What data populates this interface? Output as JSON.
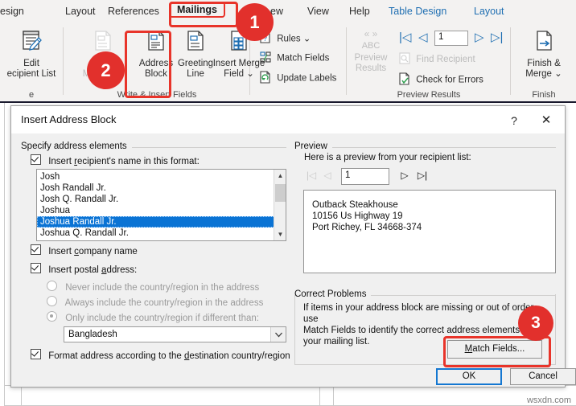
{
  "ribbon": {
    "tabs": [
      {
        "label": "esign",
        "type": "normal"
      },
      {
        "label": "Layout",
        "type": "normal"
      },
      {
        "label": "References",
        "type": "normal"
      },
      {
        "label": "Mailings",
        "type": "selected"
      },
      {
        "label": "ew",
        "type": "normal"
      },
      {
        "label": "View",
        "type": "normal"
      },
      {
        "label": "Help",
        "type": "normal"
      },
      {
        "label": "Table Design",
        "type": "contextual"
      },
      {
        "label": "Layout",
        "type": "contextual"
      }
    ],
    "groups": [
      {
        "name": "start-mail-merge",
        "label": "e"
      },
      {
        "name": "write-insert-fields",
        "label": "Write & Insert Fields"
      },
      {
        "name": "preview-results",
        "label": "Preview Results"
      },
      {
        "name": "finish",
        "label": "Finish"
      }
    ],
    "buttons": {
      "edit_recipient_list": {
        "line1": "Edit",
        "line2": "ecipient List",
        "icon": "edit-recipient-list-icon"
      },
      "highlight_merge_fields": {
        "line1": "Hig",
        "line2": "Merg     elds",
        "icon": "highlight-merge-fields-icon"
      },
      "address_block": {
        "line1": "Address",
        "line2": "Block",
        "icon": "address-block-icon"
      },
      "greeting_line": {
        "line1": "Greeting",
        "line2": "Line",
        "icon": "greeting-line-icon"
      },
      "insert_merge_field": {
        "line1": "Insert Merge",
        "line2": "Field ⌄",
        "icon": "insert-merge-field-icon"
      },
      "rules": {
        "label": "Rules ⌄",
        "icon": "rules-icon"
      },
      "match_fields": {
        "label": "Match Fields",
        "icon": "match-fields-icon"
      },
      "update_labels": {
        "label": "Update Labels",
        "icon": "update-labels-icon"
      },
      "preview_results": {
        "line1": "Preview",
        "line2": "Results",
        "abc": "ABC",
        "arrows": "« »",
        "icon": "preview-results-icon"
      },
      "find_recipient": {
        "label": "Find Recipient",
        "icon": "find-recipient-icon"
      },
      "check_for_errors": {
        "label": "Check for Errors",
        "icon": "check-for-errors-icon"
      },
      "finish_merge": {
        "line1": "Finish &",
        "line2": "Merge ⌄",
        "icon": "finish-merge-icon"
      },
      "record_nav": {
        "value": "1",
        "first": "|◁",
        "prev": "◁",
        "next": "▷",
        "last": "▷|"
      }
    },
    "callouts": [
      {
        "number": "1"
      },
      {
        "number": "2"
      }
    ]
  },
  "dialog": {
    "title": "Insert Address Block",
    "help_icon": "?",
    "close_icon": "✕",
    "left": {
      "group_title": "Specify address elements",
      "insert_name": {
        "label_pre": "Insert ",
        "label_key": "r",
        "label_post": "ecipient's name in this format:",
        "checked": true
      },
      "name_formats": [
        {
          "text": "Josh",
          "selected": false
        },
        {
          "text": "Josh Randall Jr.",
          "selected": false
        },
        {
          "text": "Josh Q. Randall Jr.",
          "selected": false
        },
        {
          "text": "Joshua",
          "selected": false
        },
        {
          "text": "Joshua Randall Jr.",
          "selected": true
        },
        {
          "text": "Joshua Q. Randall Jr.",
          "selected": false
        }
      ],
      "insert_company": {
        "label_pre": "Insert ",
        "label_key": "c",
        "label_post": "ompany name",
        "checked": true
      },
      "insert_postal": {
        "label_pre": "Insert postal ",
        "label_key": "a",
        "label_post": "ddress:",
        "checked": true
      },
      "country_options": [
        {
          "text": "Never include the country/region in the address",
          "selected": false
        },
        {
          "text": "Always include the country/region in the address",
          "selected": false
        },
        {
          "text": "Only include the country/region if different than:",
          "selected": true
        }
      ],
      "country_combo": {
        "value": "Bangladesh",
        "arrow": "⌄"
      },
      "format_address": {
        "label_pre": "Format address according to the ",
        "label_key": "d",
        "label_post": "estination country/region",
        "checked": true
      }
    },
    "preview": {
      "group_title": "Preview",
      "caption": "Here is a preview from your recipient list:",
      "nav": {
        "first": "|◁",
        "prev": "◁",
        "value": "1",
        "next": "▷",
        "last": "▷|"
      },
      "address_lines": [
        "Outback Steakhouse",
        "10156 Us Highway 19",
        "Port Richey, FL 34668-374"
      ]
    },
    "correct_problems": {
      "group_title": "Correct Problems",
      "text_lines": [
        "If items in your address block are missing or out of order, use",
        "Match Fields to identify the correct address elements from",
        "your mailing list."
      ],
      "match_fields_button": {
        "label_pre": "",
        "label_key": "M",
        "label_post": "atch Fields..."
      }
    },
    "footer": {
      "ok": "OK",
      "cancel": "Cancel"
    },
    "callouts": [
      {
        "number": "3"
      }
    ]
  },
  "watermark": "wsxdn.com",
  "colors": {
    "accent_red": "#e2302c",
    "selection_blue": "#0a73d4",
    "contextual_tab": "#1f6fb2",
    "ok_border": "#1477d1"
  }
}
